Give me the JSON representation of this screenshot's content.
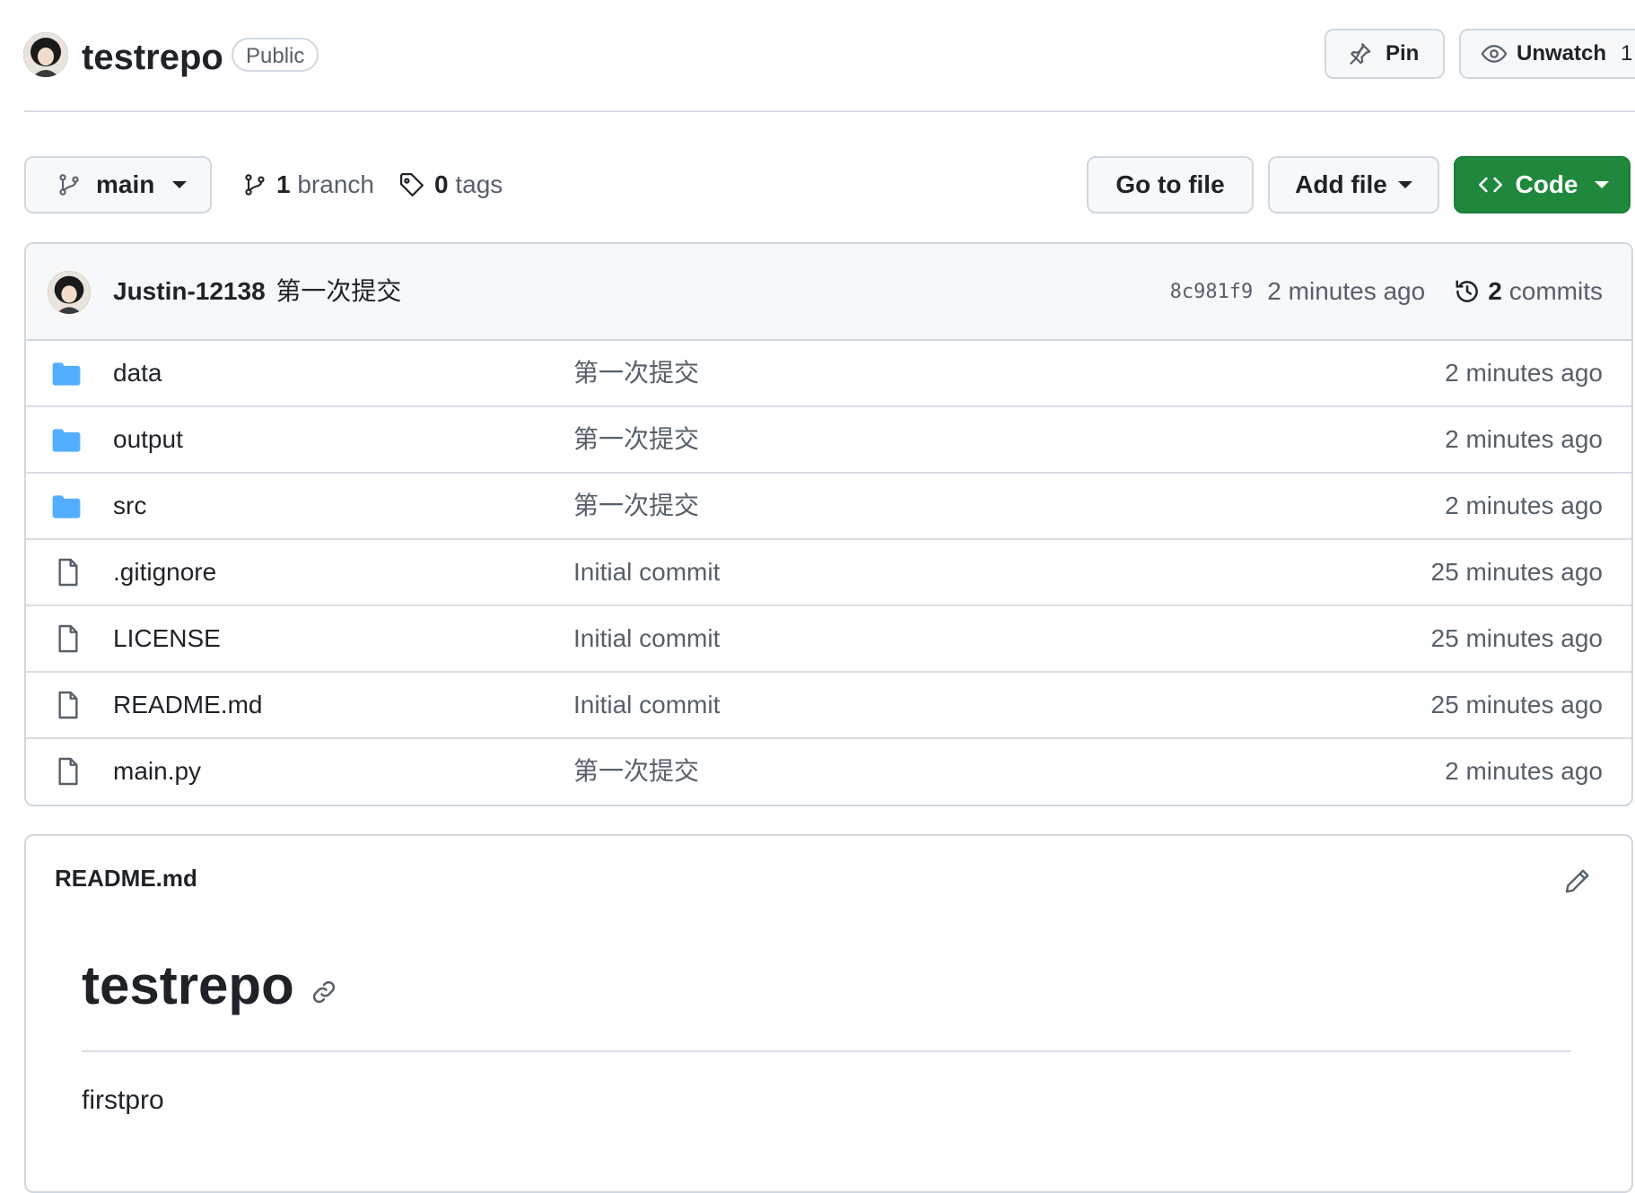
{
  "header": {
    "repo_name": "testrepo",
    "visibility": "Public",
    "pin_label": "Pin",
    "unwatch_label": "Unwatch",
    "watch_count": "1"
  },
  "branch_bar": {
    "branch": "main",
    "branch_count": "1",
    "branch_word": "branch",
    "tag_count": "0",
    "tag_word": "tags",
    "goto_file": "Go to file",
    "add_file": "Add file",
    "code": "Code"
  },
  "latest_commit": {
    "author": "Justin-12138",
    "message": "第一次提交",
    "sha": "8c981f9",
    "age": "2 minutes ago",
    "commit_count": "2",
    "commit_word": "commits"
  },
  "files": [
    {
      "name": "data",
      "type": "folder",
      "message": "第一次提交",
      "age": "2 minutes ago"
    },
    {
      "name": "output",
      "type": "folder",
      "message": "第一次提交",
      "age": "2 minutes ago"
    },
    {
      "name": "src",
      "type": "folder",
      "message": "第一次提交",
      "age": "2 minutes ago"
    },
    {
      "name": ".gitignore",
      "type": "file",
      "message": "Initial commit",
      "age": "25 minutes ago"
    },
    {
      "name": "LICENSE",
      "type": "file",
      "message": "Initial commit",
      "age": "25 minutes ago"
    },
    {
      "name": "README.md",
      "type": "file",
      "message": "Initial commit",
      "age": "25 minutes ago"
    },
    {
      "name": "main.py",
      "type": "file",
      "message": "第一次提交",
      "age": "2 minutes ago"
    }
  ],
  "readme": {
    "filename": "README.md",
    "heading": "testrepo",
    "body": "firstpro"
  },
  "colors": {
    "accent_green": "#1f883d",
    "folder_blue": "#54aeff",
    "muted_text": "#57606a",
    "border": "#d0d7de"
  }
}
